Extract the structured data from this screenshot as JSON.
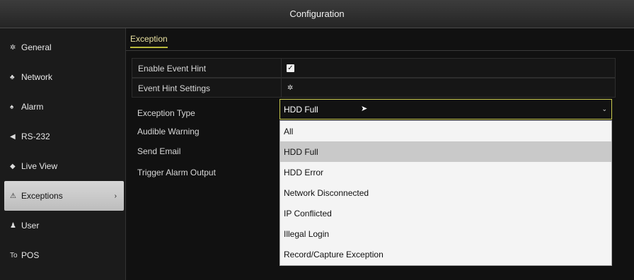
{
  "window": {
    "title": "Configuration"
  },
  "sidebar": {
    "items": [
      {
        "label": "General",
        "icon": "gear-icon"
      },
      {
        "label": "Network",
        "icon": "network-icon"
      },
      {
        "label": "Alarm",
        "icon": "alarm-icon"
      },
      {
        "label": "RS-232",
        "icon": "rs232-icon"
      },
      {
        "label": "Live View",
        "icon": "eye-icon"
      },
      {
        "label": "Exceptions",
        "icon": "warning-icon",
        "active": true
      },
      {
        "label": "User",
        "icon": "users-icon"
      },
      {
        "label": "POS",
        "icon": "pos-icon"
      }
    ]
  },
  "main": {
    "tab": "Exception",
    "fields": {
      "enable_event_hint": {
        "label": "Enable Event Hint",
        "checked": true
      },
      "event_hint_settings": {
        "label": "Event Hint Settings"
      },
      "exception_type": {
        "label": "Exception Type",
        "value": "HDD Full"
      },
      "audible_warning": {
        "label": "Audible Warning"
      },
      "send_email": {
        "label": "Send Email"
      },
      "trigger_alarm_output": {
        "label": "Trigger Alarm Output"
      }
    },
    "dropdown": {
      "options": [
        "All",
        "HDD Full",
        "HDD Error",
        "Network Disconnected",
        "IP Conflicted",
        "Illegal Login",
        "Record/Capture Exception"
      ],
      "highlighted": "HDD Full"
    }
  },
  "colors": {
    "accent": "#c9c94d",
    "active_sidebar": "#cfcfcf",
    "background": "#111111"
  }
}
